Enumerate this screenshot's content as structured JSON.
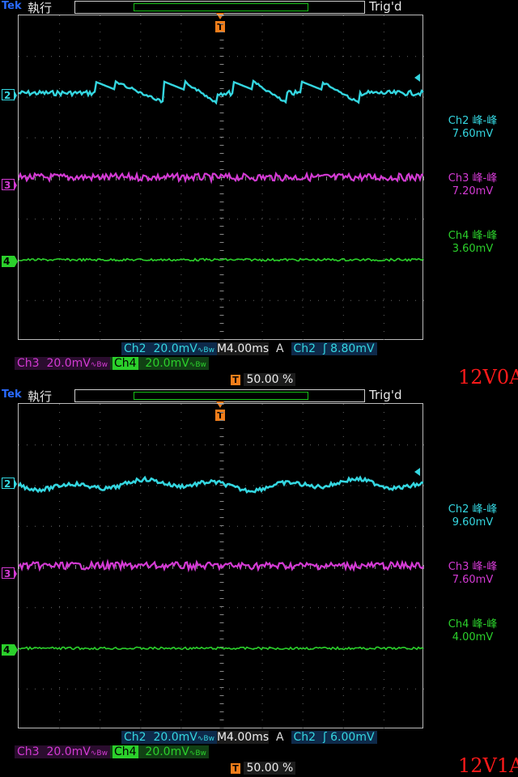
{
  "panels": [
    {
      "brand": "Tek",
      "run_state": "執行",
      "trigger_state": "Trig'd",
      "trigger_marker": "T",
      "channels": [
        {
          "label": "2",
          "color": "#34d6e0"
        },
        {
          "label": "3",
          "color": "#d43ad4"
        },
        {
          "label": "4",
          "color": "#2bd02b"
        }
      ],
      "measurements": [
        {
          "name": "Ch2 峰-峰",
          "value": "7.60mV",
          "color": "#34d6e0"
        },
        {
          "name": "Ch3 峰-峰",
          "value": "7.20mV",
          "color": "#d43ad4"
        },
        {
          "name": "Ch4 峰-峰",
          "value": "3.60mV",
          "color": "#2bd02b"
        }
      ],
      "ch2_name": "Ch2",
      "ch2_scale": "20.0mV",
      "bw_symbol": "∿Bw",
      "timebase": "M4.00ms",
      "trigger_mode": "A",
      "trigger_source": "Ch2",
      "trigger_slope": "ʃ",
      "trigger_level": "8.80mV",
      "ch3_name": "Ch3",
      "ch3_scale": "20.0mV",
      "ch4_name": "Ch4",
      "ch4_scale": "20.0mV",
      "trigger_position": "50.00 %",
      "load_label": "12V0A"
    },
    {
      "brand": "Tek",
      "run_state": "執行",
      "trigger_state": "Trig'd",
      "trigger_marker": "T",
      "channels": [
        {
          "label": "2",
          "color": "#34d6e0"
        },
        {
          "label": "3",
          "color": "#d43ad4"
        },
        {
          "label": "4",
          "color": "#2bd02b"
        }
      ],
      "measurements": [
        {
          "name": "Ch2 峰-峰",
          "value": "9.60mV",
          "color": "#34d6e0"
        },
        {
          "name": "Ch3 峰-峰",
          "value": "7.60mV",
          "color": "#d43ad4"
        },
        {
          "name": "Ch4 峰-峰",
          "value": "4.00mV",
          "color": "#2bd02b"
        }
      ],
      "ch2_name": "Ch2",
      "ch2_scale": "20.0mV",
      "bw_symbol": "∿Bw",
      "timebase": "M4.00ms",
      "trigger_mode": "A",
      "trigger_source": "Ch2",
      "trigger_slope": "ʃ",
      "trigger_level": "6.00mV",
      "ch3_name": "Ch3",
      "ch3_scale": "20.0mV",
      "ch4_name": "Ch4",
      "ch4_scale": "20.0mV",
      "trigger_position": "50.00 %",
      "load_label": "12V1A"
    }
  ]
}
